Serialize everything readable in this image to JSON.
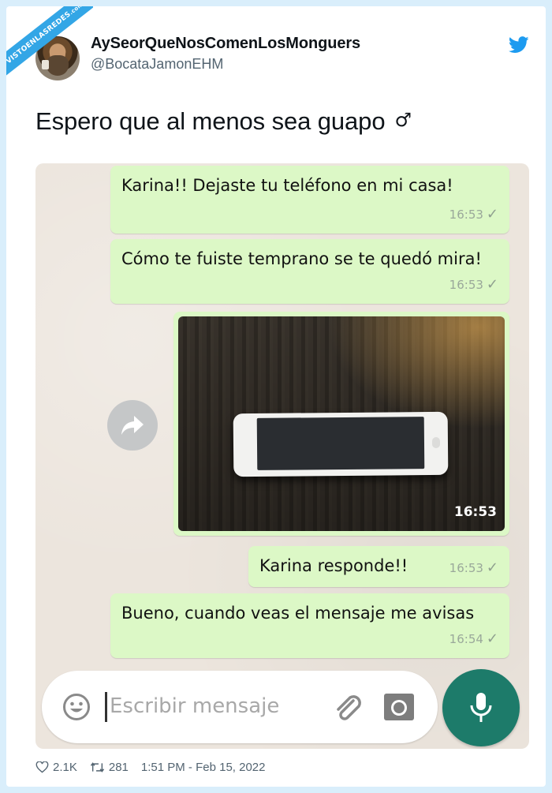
{
  "watermark": {
    "text": "VISTOENLASREDES",
    "suffix": ".com"
  },
  "author": {
    "name": "AySeorQueNosComenLosMonguers",
    "handle": "@BocataJamonEHM"
  },
  "tweet": {
    "text": "Espero que al menos sea guapo",
    "emoji": "♂"
  },
  "chat": {
    "messages": [
      {
        "text": "Karina!! Dejaste tu teléfono en mi casa!",
        "time": "16:53",
        "status": "✓"
      },
      {
        "text": "Cómo te fuiste temprano se te quedó mira!",
        "time": "16:53",
        "status": "✓"
      },
      {
        "time": "16:53"
      },
      {
        "text": "Karina responde!!",
        "time": "16:53",
        "status": "✓"
      },
      {
        "text": "Bueno, cuando veas el mensaje me avisas",
        "time": "16:54",
        "status": "✓"
      }
    ],
    "input": {
      "placeholder": "Escribir mensaje"
    }
  },
  "stats": {
    "likes": "2.1K",
    "retweets": "281",
    "timestamp": "1:51 PM - Feb 15, 2022"
  },
  "colors": {
    "bubble": "#dcf8c6",
    "mic": "#1d7b6a",
    "twitter": "#1d9bf0"
  },
  "icons": [
    "twitter-bird-icon",
    "forward-icon",
    "emoji-icon",
    "paperclip-icon",
    "camera-icon",
    "microphone-icon",
    "heart-icon",
    "retweet-icon"
  ]
}
